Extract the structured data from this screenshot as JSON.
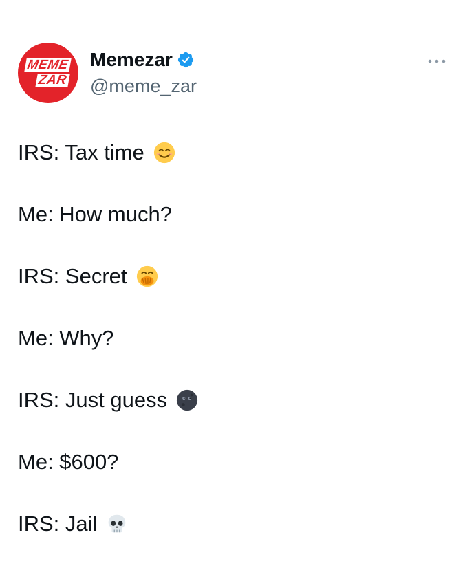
{
  "author": {
    "avatar_text_line1": "MEME",
    "avatar_text_line2": "ZAR",
    "display_name": "Memezar",
    "handle": "@meme_zar",
    "verified": true
  },
  "menu_icon": "more-horizontal-icon",
  "colors": {
    "brand_red": "#e3232a",
    "verified_blue": "#1d9bf0",
    "text": "#0f1419",
    "secondary_text": "#536471"
  },
  "lines": [
    {
      "text": "IRS: Tax time",
      "emoji": "smiling-face-icon"
    },
    {
      "text": "Me: How much?",
      "emoji": ""
    },
    {
      "text": "IRS: Secret",
      "emoji": "face-with-hand-over-mouth-icon"
    },
    {
      "text": "Me: Why?",
      "emoji": ""
    },
    {
      "text": "IRS: Just guess",
      "emoji": "new-moon-face-icon"
    },
    {
      "text": "Me: $600?",
      "emoji": ""
    },
    {
      "text": "IRS: Jail",
      "emoji": "skull-icon"
    }
  ]
}
